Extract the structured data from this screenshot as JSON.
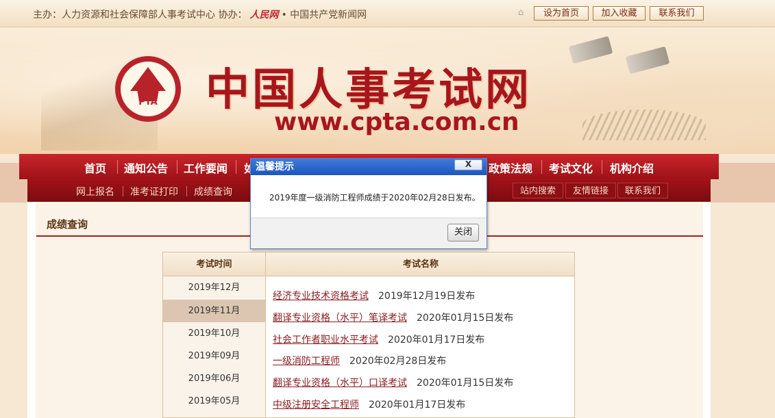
{
  "topbar": {
    "sponsor_prefix": "主办：人力资源和社会保障部人事考试中心 协办：",
    "partner_logo": "人民网",
    "partner_suffix": "• 中国共产党新闻网",
    "buttons": [
      "设为首页",
      "加入收藏",
      "联系我们"
    ]
  },
  "banner": {
    "emblem_text": "PTA",
    "title": "中国人事考试网",
    "url": "www.cpta.com.cn"
  },
  "nav": {
    "items": [
      "首页",
      "通知公告",
      "工作要闻",
      "如",
      "政策法规",
      "考试文化",
      "机构介绍"
    ]
  },
  "subnav": {
    "items": [
      "网上报名",
      "准考证打印",
      "成绩查询"
    ],
    "right_items": [
      "站内搜索",
      "友情链接",
      "联系我们"
    ]
  },
  "content": {
    "section_title": "成绩查询",
    "table": {
      "headers": [
        "考试时间",
        "考试名称"
      ],
      "months": [
        "2019年12月",
        "2019年11月",
        "2019年10月",
        "2019年09月",
        "2019年06月",
        "2019年05月"
      ],
      "active_month_index": 1,
      "rows": [
        {
          "name": "经济专业技术资格考试",
          "date": "2019年12月19日发布"
        },
        {
          "name": "翻译专业资格（水平）笔译考试",
          "date": "2020年01月15日发布"
        },
        {
          "name": "社会工作者职业水平考试",
          "date": "2020年01月17日发布"
        },
        {
          "name": "一级消防工程师",
          "date": "2020年02月28日发布"
        },
        {
          "name": "翻译专业资格（水平）口译考试",
          "date": "2020年01月15日发布"
        },
        {
          "name": "中级注册安全工程师",
          "date": "2020年01月17日发布"
        }
      ]
    }
  },
  "modal": {
    "title": "温馨提示",
    "close_label": "X",
    "message": "2019年度一级消防工程师成绩于2020年02月28日发布。",
    "button_label": "关闭"
  },
  "colors": {
    "brand_red": "#a8161d",
    "nav_red": "#c9252b",
    "modal_blue": "#1c56bd"
  }
}
